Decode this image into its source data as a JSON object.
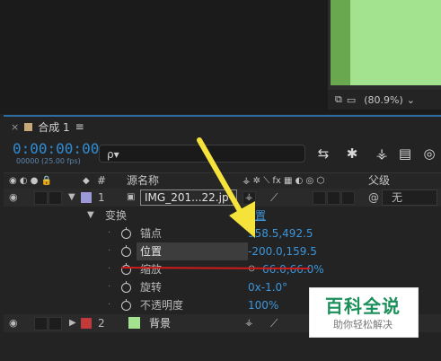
{
  "viewer": {
    "zoom": "(80.9%)",
    "zoom_caret": "⌄",
    "icons": [
      "snapshot-icon",
      "monitor-icon"
    ]
  },
  "timeline": {
    "tab_close": "×",
    "tab_label": "合成 1",
    "tab_menu": "≡",
    "timecode": "0:00:00:00",
    "fps": "00000 (25.00 fps)",
    "search_placeholder": "ρ▾",
    "columns": {
      "switches": "◉ ◐ ● 🔒",
      "label_icon": "◆",
      "number": "#",
      "source_name": "源名称",
      "parent": "父级"
    }
  },
  "layers": [
    {
      "number": "1",
      "name": "IMG_201...22.jp",
      "label_color": "#9b9ad6",
      "parent": "无",
      "expanded": true,
      "transform_group": "变换",
      "transform_reset": "重置",
      "properties": [
        {
          "name": "锚点",
          "value": "358.5,492.5"
        },
        {
          "name": "位置",
          "value": "-200.0,159.5"
        },
        {
          "name": "缩放",
          "value": "66.0,66.0%"
        },
        {
          "name": "旋转",
          "value": "0x-1.0°"
        },
        {
          "name": "不透明度",
          "value": "100%"
        }
      ]
    },
    {
      "number": "2",
      "name": "背景",
      "label_color": "#c03a3a",
      "swatch_color": "#a3e28f",
      "expanded": false
    }
  ],
  "watermark": {
    "title": "百科全说",
    "subtitle": "助你轻松解决"
  },
  "annotation_arrow_color": "#f5e23a",
  "annotation_line_color": "#d11b1b"
}
